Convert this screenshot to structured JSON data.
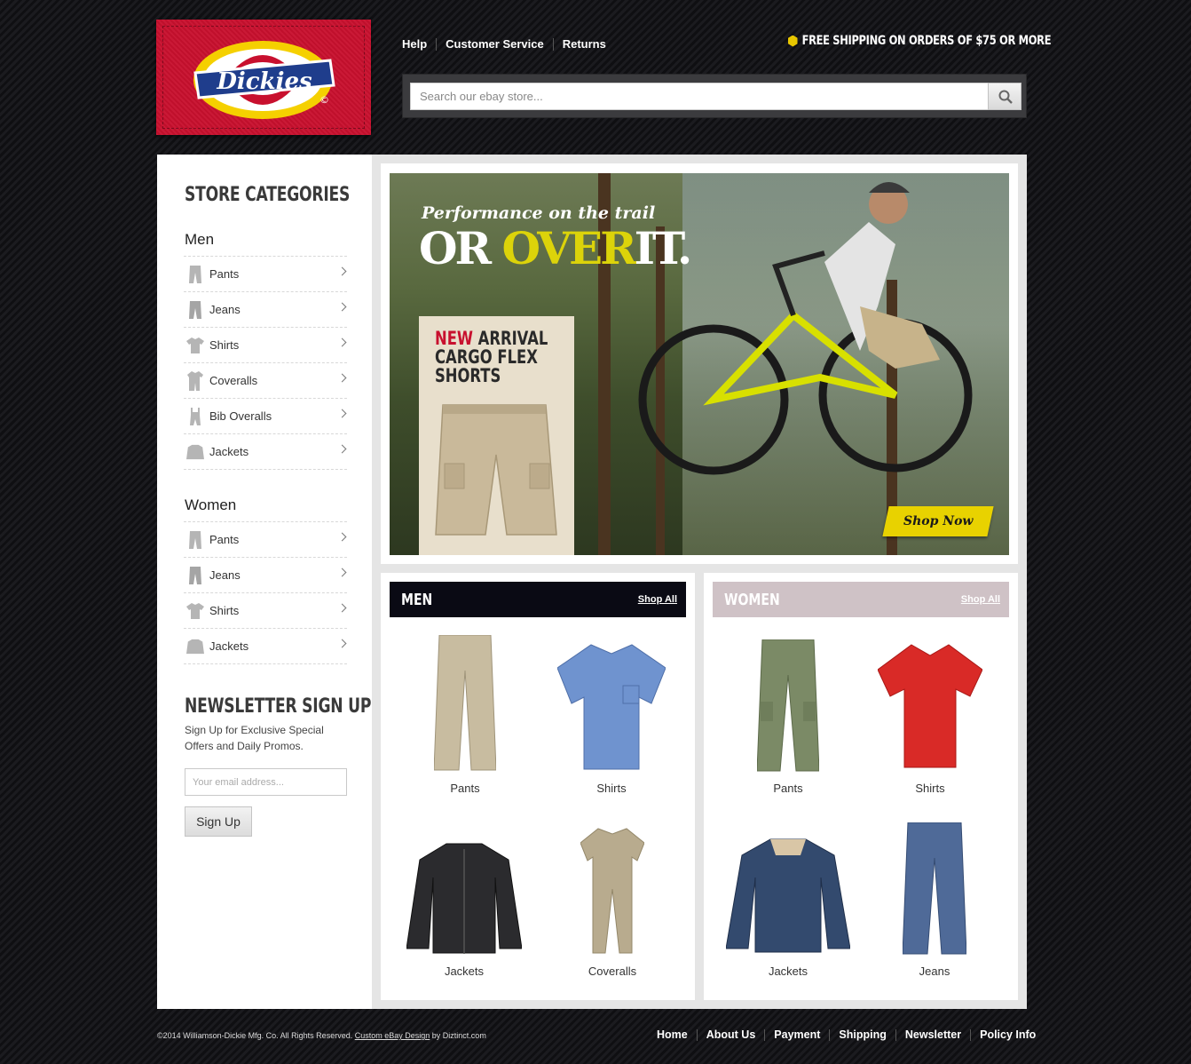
{
  "brand": {
    "logo_text": "Dickies"
  },
  "header": {
    "links": [
      "Help",
      "Customer Service",
      "Returns"
    ],
    "free_shipping": "FREE SHIPPING ON ORDERS OF $75 OR MORE",
    "search_placeholder": "Search our ebay store..."
  },
  "sidebar": {
    "title": "STORE CATEGORIES",
    "men": {
      "title": "Men",
      "items": [
        {
          "label": "Pants",
          "icon": "pants-icon"
        },
        {
          "label": "Jeans",
          "icon": "jeans-icon"
        },
        {
          "label": "Shirts",
          "icon": "shirt-icon"
        },
        {
          "label": "Coveralls",
          "icon": "coveralls-icon"
        },
        {
          "label": "Bib Overalls",
          "icon": "bib-overalls-icon"
        },
        {
          "label": "Jackets",
          "icon": "jacket-icon"
        }
      ]
    },
    "women": {
      "title": "Women",
      "items": [
        {
          "label": "Pants",
          "icon": "pants-icon"
        },
        {
          "label": "Jeans",
          "icon": "jeans-icon"
        },
        {
          "label": "Shirts",
          "icon": "shirt-icon"
        },
        {
          "label": "Jackets",
          "icon": "jacket-icon"
        }
      ]
    },
    "newsletter": {
      "title": "NEWSLETTER SIGN UP",
      "description": "Sign Up for Exclusive Special Offers and Daily Promos.",
      "email_placeholder": "Your email address...",
      "button": "Sign Up"
    }
  },
  "hero": {
    "tagline": "Performance on the trail",
    "headline_1": "OR",
    "headline_2": "OVER",
    "headline_3": "IT.",
    "promo_new": "NEW",
    "promo_arrival": "ARRIVAL",
    "promo_line2": "CARGO FLEX",
    "promo_line3": "SHORTS",
    "cta": "Shop Now"
  },
  "sections": {
    "men": {
      "title": "MEN",
      "shop_all": "Shop All",
      "products": [
        "Pants",
        "Shirts",
        "Jackets",
        "Coveralls"
      ]
    },
    "women": {
      "title": "WOMEN",
      "shop_all": "Shop All",
      "products": [
        "Pants",
        "Shirts",
        "Jackets",
        "Jeans"
      ]
    }
  },
  "footer": {
    "copyright": "©2014 Williamson-Dickie Mfg. Co. All Rights Reserved.",
    "design_link": "Custom eBay Design",
    "design_by": "by Diztinct.com",
    "links": [
      "Home",
      "About Us",
      "Payment",
      "Shipping",
      "Newsletter",
      "Policy Info"
    ]
  },
  "colors": {
    "brand_red": "#c8102e",
    "accent_yellow": "#dcd30a",
    "men_header": "#0a0a14",
    "women_header": "#cfc2c6"
  }
}
